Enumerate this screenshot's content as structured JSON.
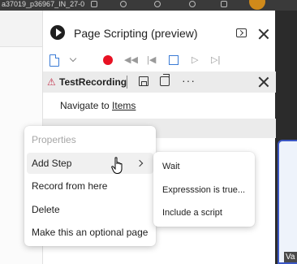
{
  "top_strip": {
    "tab_text": "a37019_p36967_IN_27-0"
  },
  "pane": {
    "title": "Page Scripting (preview)"
  },
  "toolbar": {
    "icons": [
      "new-page-icon",
      "chevron-down-icon",
      "record-icon",
      "rewind-icon",
      "skip-back-icon",
      "stop-icon",
      "play-icon",
      "skip-forward-icon"
    ]
  },
  "recording": {
    "name": "TestRecording",
    "more": "···"
  },
  "step": {
    "prefix": "Navigate to ",
    "link": "Items"
  },
  "context_menu": {
    "items": [
      {
        "label": "Properties",
        "disabled": true
      },
      {
        "label": "Add Step",
        "has_submenu": true
      },
      {
        "label": "Record from here"
      },
      {
        "label": "Delete"
      },
      {
        "label": "Make this an optional page"
      }
    ]
  },
  "submenu": {
    "items": [
      "Wait",
      "Expresssion is true...",
      "Include a script"
    ]
  },
  "right_panel": {
    "label": "Va"
  },
  "colors": {
    "record": "#e81123",
    "accent": "#3a7bd5",
    "warning": "#c4314b",
    "panel_border": "#3b57c4"
  }
}
